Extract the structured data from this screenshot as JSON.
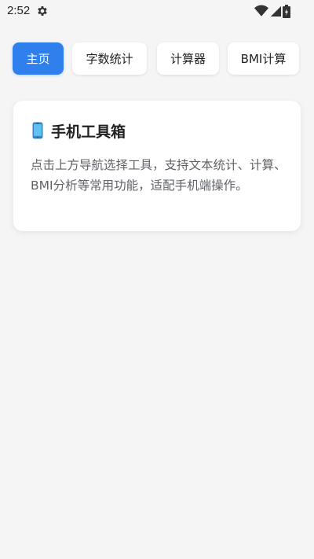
{
  "status_bar": {
    "time": "2:52",
    "icons": [
      "gear-icon",
      "wifi-icon",
      "cell-signal-icon",
      "battery-icon"
    ]
  },
  "nav": {
    "tabs": [
      {
        "label": "主页",
        "active": true
      },
      {
        "label": "字数统计",
        "active": false
      },
      {
        "label": "计算器",
        "active": false
      },
      {
        "label": "BMI计算",
        "active": false
      }
    ]
  },
  "card": {
    "icon": "phone-icon",
    "title": "手机工具箱",
    "description": "点击上方导航选择工具，支持文本统计、计算、BMI分析等常用功能，适配手机端操作。"
  },
  "colors": {
    "accent": "#2f80ed",
    "background": "#f5f5f6",
    "card": "#ffffff"
  }
}
